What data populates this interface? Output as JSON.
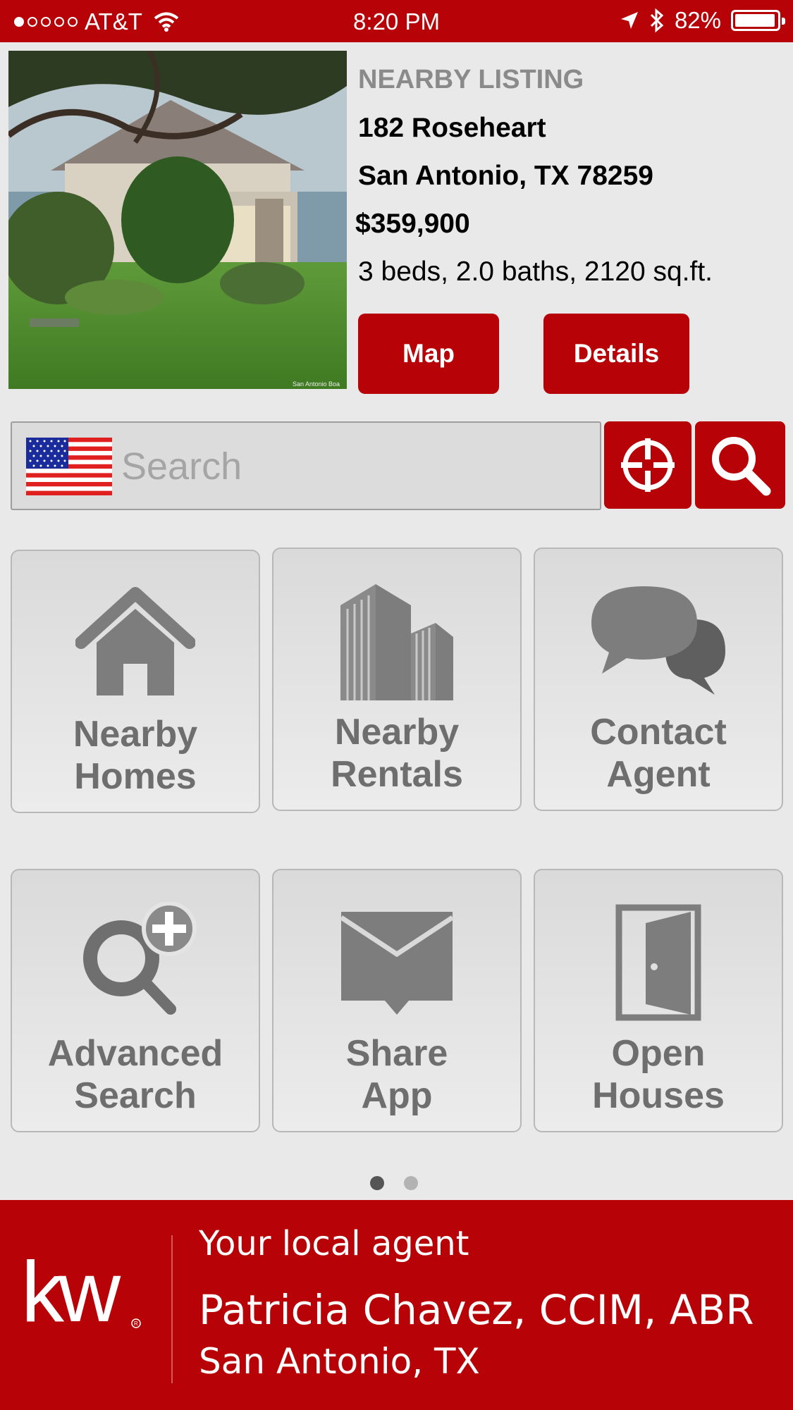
{
  "status_bar": {
    "carrier": "AT&T",
    "time": "8:20 PM",
    "battery": "82%",
    "signal_dots_filled": 1,
    "signal_dots_total": 5
  },
  "listing": {
    "section_label": "NEARBY LISTING",
    "address_line1": "182 Roseheart",
    "address_line2": "San Antonio, TX 78259",
    "price": "$359,900",
    "specs": "3 beds, 2.0 baths, 2120 sq.ft.",
    "photo_credit": "San Antonio Boa",
    "map_label": "Map",
    "details_label": "Details"
  },
  "search": {
    "placeholder": "Search",
    "value": ""
  },
  "tiles": [
    {
      "line1": "Nearby",
      "line2": "Homes",
      "icon": "house-icon"
    },
    {
      "line1": "Nearby",
      "line2": "Rentals",
      "icon": "buildings-icon"
    },
    {
      "line1": "Contact",
      "line2": "Agent",
      "icon": "chat-bubbles-icon"
    },
    {
      "line1": "Advanced",
      "line2": "Search",
      "icon": "search-plus-icon"
    },
    {
      "line1": "Share",
      "line2": "App",
      "icon": "envelope-icon"
    },
    {
      "line1": "Open",
      "line2": "Houses",
      "icon": "door-icon"
    }
  ],
  "pagination": {
    "current_page": 1,
    "total_pages": 2
  },
  "footer": {
    "logo_text": "kw",
    "tagline": "Your local agent",
    "agent_name": "Patricia Chavez, CCIM, ABR",
    "location": "San Antonio, TX"
  },
  "colors": {
    "brand_red": "#b70207",
    "background": "#e9e9e9",
    "tile_text": "#6e6e6e",
    "icon_gray": "#7d7d7d"
  }
}
